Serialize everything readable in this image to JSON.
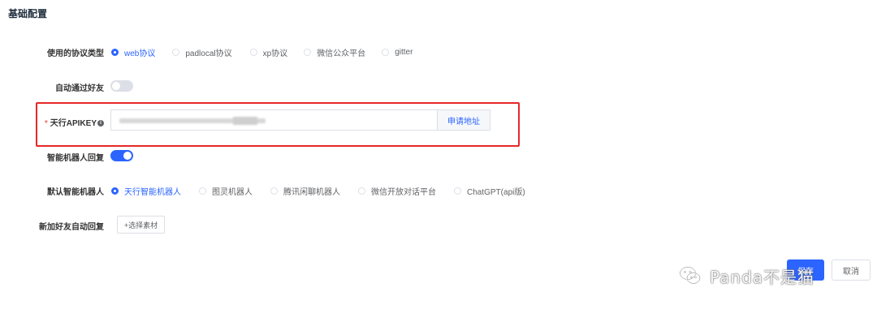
{
  "section_title": "基础配置",
  "protocol": {
    "label": "使用的协议类型",
    "options": [
      {
        "label": "web协议",
        "checked": true
      },
      {
        "label": "padlocal协议",
        "checked": false
      },
      {
        "label": "xp协议",
        "checked": false
      },
      {
        "label": "微信公众平台",
        "checked": false
      },
      {
        "label": "gitter",
        "checked": false
      }
    ]
  },
  "auto_accept": {
    "label": "自动通过好友",
    "on": false
  },
  "api_key": {
    "required_mark": "*",
    "label": "天行APIKEY",
    "info_icon": "info-icon",
    "value": "",
    "apply_label": "申请地址"
  },
  "smart_reply": {
    "label": "智能机器人回复",
    "on": true
  },
  "default_bot": {
    "label": "默认智能机器人",
    "options": [
      {
        "label": "天行智能机器人",
        "checked": true
      },
      {
        "label": "图灵机器人",
        "checked": false
      },
      {
        "label": "腾讯闲聊机器人",
        "checked": false
      },
      {
        "label": "微信开放对话平台",
        "checked": false
      },
      {
        "label": "ChatGPT(api版)",
        "checked": false
      }
    ]
  },
  "new_friend_reply": {
    "label": "新加好友自动回复",
    "button_label": "+选择素材"
  },
  "footer": {
    "save_label": "保存",
    "cancel_label": "取消"
  },
  "watermark": {
    "text": "Panda不是猫"
  },
  "colors": {
    "accent": "#2b64ff",
    "highlight": "#e62727",
    "required": "#f56c6c"
  }
}
